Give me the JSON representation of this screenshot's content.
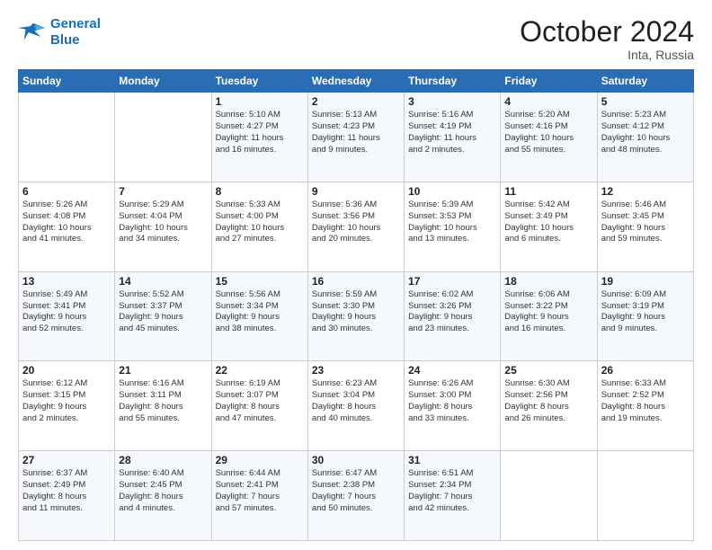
{
  "logo": {
    "line1": "General",
    "line2": "Blue"
  },
  "header": {
    "month": "October 2024",
    "location": "Inta, Russia"
  },
  "weekdays": [
    "Sunday",
    "Monday",
    "Tuesday",
    "Wednesday",
    "Thursday",
    "Friday",
    "Saturday"
  ],
  "weeks": [
    [
      {
        "day": "",
        "info": ""
      },
      {
        "day": "",
        "info": ""
      },
      {
        "day": "1",
        "info": "Sunrise: 5:10 AM\nSunset: 4:27 PM\nDaylight: 11 hours\nand 16 minutes."
      },
      {
        "day": "2",
        "info": "Sunrise: 5:13 AM\nSunset: 4:23 PM\nDaylight: 11 hours\nand 9 minutes."
      },
      {
        "day": "3",
        "info": "Sunrise: 5:16 AM\nSunset: 4:19 PM\nDaylight: 11 hours\nand 2 minutes."
      },
      {
        "day": "4",
        "info": "Sunrise: 5:20 AM\nSunset: 4:16 PM\nDaylight: 10 hours\nand 55 minutes."
      },
      {
        "day": "5",
        "info": "Sunrise: 5:23 AM\nSunset: 4:12 PM\nDaylight: 10 hours\nand 48 minutes."
      }
    ],
    [
      {
        "day": "6",
        "info": "Sunrise: 5:26 AM\nSunset: 4:08 PM\nDaylight: 10 hours\nand 41 minutes."
      },
      {
        "day": "7",
        "info": "Sunrise: 5:29 AM\nSunset: 4:04 PM\nDaylight: 10 hours\nand 34 minutes."
      },
      {
        "day": "8",
        "info": "Sunrise: 5:33 AM\nSunset: 4:00 PM\nDaylight: 10 hours\nand 27 minutes."
      },
      {
        "day": "9",
        "info": "Sunrise: 5:36 AM\nSunset: 3:56 PM\nDaylight: 10 hours\nand 20 minutes."
      },
      {
        "day": "10",
        "info": "Sunrise: 5:39 AM\nSunset: 3:53 PM\nDaylight: 10 hours\nand 13 minutes."
      },
      {
        "day": "11",
        "info": "Sunrise: 5:42 AM\nSunset: 3:49 PM\nDaylight: 10 hours\nand 6 minutes."
      },
      {
        "day": "12",
        "info": "Sunrise: 5:46 AM\nSunset: 3:45 PM\nDaylight: 9 hours\nand 59 minutes."
      }
    ],
    [
      {
        "day": "13",
        "info": "Sunrise: 5:49 AM\nSunset: 3:41 PM\nDaylight: 9 hours\nand 52 minutes."
      },
      {
        "day": "14",
        "info": "Sunrise: 5:52 AM\nSunset: 3:37 PM\nDaylight: 9 hours\nand 45 minutes."
      },
      {
        "day": "15",
        "info": "Sunrise: 5:56 AM\nSunset: 3:34 PM\nDaylight: 9 hours\nand 38 minutes."
      },
      {
        "day": "16",
        "info": "Sunrise: 5:59 AM\nSunset: 3:30 PM\nDaylight: 9 hours\nand 30 minutes."
      },
      {
        "day": "17",
        "info": "Sunrise: 6:02 AM\nSunset: 3:26 PM\nDaylight: 9 hours\nand 23 minutes."
      },
      {
        "day": "18",
        "info": "Sunrise: 6:06 AM\nSunset: 3:22 PM\nDaylight: 9 hours\nand 16 minutes."
      },
      {
        "day": "19",
        "info": "Sunrise: 6:09 AM\nSunset: 3:19 PM\nDaylight: 9 hours\nand 9 minutes."
      }
    ],
    [
      {
        "day": "20",
        "info": "Sunrise: 6:12 AM\nSunset: 3:15 PM\nDaylight: 9 hours\nand 2 minutes."
      },
      {
        "day": "21",
        "info": "Sunrise: 6:16 AM\nSunset: 3:11 PM\nDaylight: 8 hours\nand 55 minutes."
      },
      {
        "day": "22",
        "info": "Sunrise: 6:19 AM\nSunset: 3:07 PM\nDaylight: 8 hours\nand 47 minutes."
      },
      {
        "day": "23",
        "info": "Sunrise: 6:23 AM\nSunset: 3:04 PM\nDaylight: 8 hours\nand 40 minutes."
      },
      {
        "day": "24",
        "info": "Sunrise: 6:26 AM\nSunset: 3:00 PM\nDaylight: 8 hours\nand 33 minutes."
      },
      {
        "day": "25",
        "info": "Sunrise: 6:30 AM\nSunset: 2:56 PM\nDaylight: 8 hours\nand 26 minutes."
      },
      {
        "day": "26",
        "info": "Sunrise: 6:33 AM\nSunset: 2:52 PM\nDaylight: 8 hours\nand 19 minutes."
      }
    ],
    [
      {
        "day": "27",
        "info": "Sunrise: 6:37 AM\nSunset: 2:49 PM\nDaylight: 8 hours\nand 11 minutes."
      },
      {
        "day": "28",
        "info": "Sunrise: 6:40 AM\nSunset: 2:45 PM\nDaylight: 8 hours\nand 4 minutes."
      },
      {
        "day": "29",
        "info": "Sunrise: 6:44 AM\nSunset: 2:41 PM\nDaylight: 7 hours\nand 57 minutes."
      },
      {
        "day": "30",
        "info": "Sunrise: 6:47 AM\nSunset: 2:38 PM\nDaylight: 7 hours\nand 50 minutes."
      },
      {
        "day": "31",
        "info": "Sunrise: 6:51 AM\nSunset: 2:34 PM\nDaylight: 7 hours\nand 42 minutes."
      },
      {
        "day": "",
        "info": ""
      },
      {
        "day": "",
        "info": ""
      }
    ]
  ]
}
